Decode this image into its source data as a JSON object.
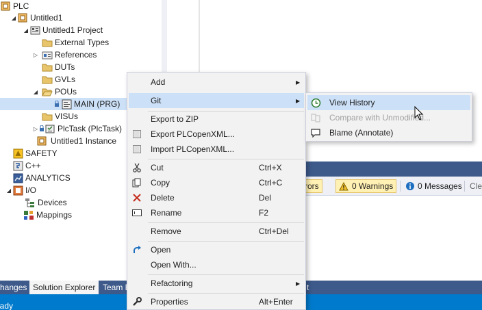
{
  "tree": {
    "items": [
      {
        "label": "PLC",
        "expander": "",
        "icon": "plc-icon"
      },
      {
        "label": "Untitled1",
        "expander": "◢",
        "icon": "plc-project-icon"
      },
      {
        "label": "Untitled1 Project",
        "expander": "◢",
        "icon": "project-icon"
      },
      {
        "label": "External Types",
        "expander": "",
        "icon": "folder-icon"
      },
      {
        "label": "References",
        "expander": "▷",
        "icon": "references-icon"
      },
      {
        "label": "DUTs",
        "expander": "",
        "icon": "folder-icon"
      },
      {
        "label": "GVLs",
        "expander": "",
        "icon": "folder-icon"
      },
      {
        "label": "POUs",
        "expander": "◢",
        "icon": "folder-open-icon"
      },
      {
        "label": "MAIN (PRG)",
        "expander": "",
        "icon": "program-icon"
      },
      {
        "label": "VISUs",
        "expander": "",
        "icon": "folder-icon"
      },
      {
        "label": "PlcTask (PlcTask)",
        "expander": "▷",
        "icon": "task-icon"
      },
      {
        "label": "Untitled1 Instance",
        "expander": "",
        "icon": "instance-icon"
      },
      {
        "label": "SAFETY",
        "expander": "",
        "icon": "safety-icon"
      },
      {
        "label": "C++",
        "expander": "",
        "icon": "cpp-icon"
      },
      {
        "label": "ANALYTICS",
        "expander": "",
        "icon": "analytics-icon"
      },
      {
        "label": "I/O",
        "expander": "◢",
        "icon": "io-icon"
      },
      {
        "label": "Devices",
        "expander": "",
        "icon": "devices-icon"
      },
      {
        "label": "Mappings",
        "expander": "",
        "icon": "mappings-icon"
      }
    ]
  },
  "error_list": {
    "errors_label": "rrors",
    "warnings_label": "0 Warnings",
    "messages_label": "0 Messages",
    "clear_label": "Cle"
  },
  "bottom_tabs": {
    "changes": "hanges",
    "solution_explorer": "Solution Explorer",
    "team": "Team E",
    "t_fragment": "t"
  },
  "status": {
    "text": "eady"
  },
  "context_menu": {
    "add": "Add",
    "git": "Git",
    "export_zip": "Export to ZIP",
    "export_plcopen": "Export PLCopenXML...",
    "import_plcopen": "Import PLCopenXML...",
    "cut": "Cut",
    "cut_shortcut": "Ctrl+X",
    "copy": "Copy",
    "copy_shortcut": "Ctrl+C",
    "delete": "Delete",
    "delete_shortcut": "Del",
    "rename": "Rename",
    "rename_shortcut": "F2",
    "remove": "Remove",
    "remove_shortcut": "Ctrl+Del",
    "open": "Open",
    "open_with": "Open With...",
    "refactoring": "Refactoring",
    "properties": "Properties",
    "properties_shortcut": "Alt+Enter"
  },
  "git_submenu": {
    "view_history": "View History",
    "compare": "Compare with Unmodified...",
    "blame": "Blame (Annotate)"
  },
  "colors": {
    "accent_blue": "#007acc",
    "panel_header": "#3d5a8a",
    "selection": "#cce0f7"
  }
}
